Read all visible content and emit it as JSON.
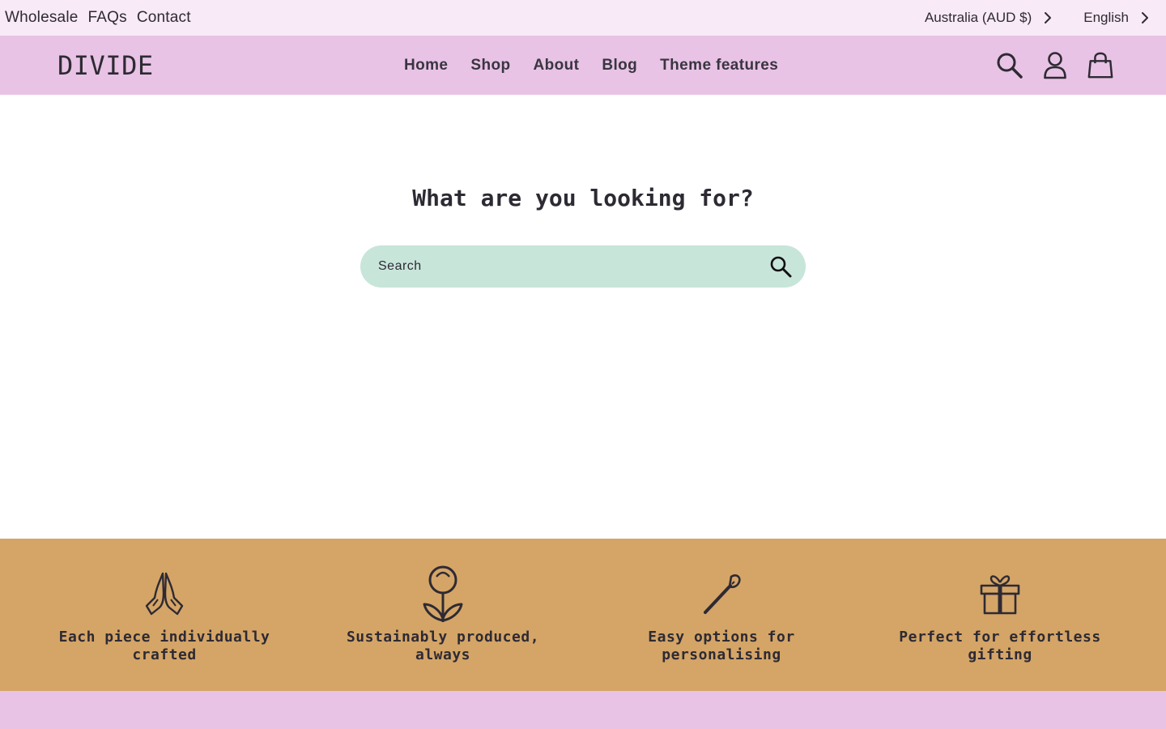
{
  "utility_bar": {
    "links": [
      "Wholesale",
      "FAQs",
      "Contact"
    ],
    "country": "Australia (AUD $)",
    "language": "English"
  },
  "header": {
    "logo": "DIVIDE",
    "nav": [
      "Home",
      "Shop",
      "About",
      "Blog",
      "Theme features"
    ],
    "icons": [
      "search-icon",
      "account-icon",
      "cart-icon"
    ]
  },
  "search": {
    "title": "What are you looking for?",
    "placeholder": "Search"
  },
  "features": [
    {
      "icon": "praying-hands-icon",
      "text": "Each piece individually crafted"
    },
    {
      "icon": "flower-icon",
      "text": "Sustainably produced, always"
    },
    {
      "icon": "paintbrush-icon",
      "text": "Easy options for personalising"
    },
    {
      "icon": "gift-icon",
      "text": "Perfect for effortless gifting"
    }
  ],
  "colors": {
    "utility_bg": "#f8eaf6",
    "header_bg": "#e8c3e5",
    "search_bg": "#c8e5da",
    "features_bg": "#d4a567",
    "text": "#2e2a33"
  }
}
